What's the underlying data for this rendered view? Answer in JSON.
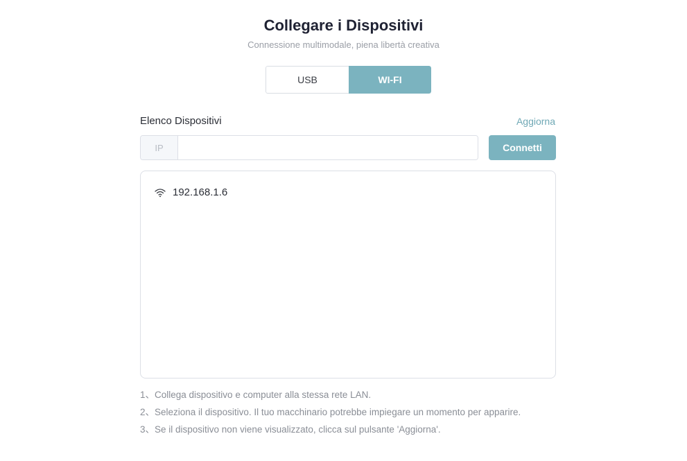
{
  "header": {
    "title": "Collegare i Dispositivi",
    "subtitle": "Connessione multimodale, piena libertà creativa"
  },
  "tabs": [
    {
      "label": "USB",
      "active": false
    },
    {
      "label": "WI-FI",
      "active": true
    }
  ],
  "device_list": {
    "label": "Elenco Dispositivi",
    "refresh_label": "Aggiorna",
    "ip_prefix": "IP",
    "ip_value": "",
    "ip_placeholder": "",
    "connect_label": "Connetti",
    "devices": [
      {
        "ip": "192.168.1.6",
        "icon": "wifi-icon"
      }
    ]
  },
  "notes": [
    "1、Collega dispositivo e computer alla stessa rete LAN.",
    "2、Seleziona il dispositivo. Il tuo macchinario potrebbe impiegare un momento per apparire.",
    "3、Se il dispositivo non viene visualizzato, clicca sul pulsante 'Aggiorna'."
  ],
  "colors": {
    "accent": "#7bb3bf",
    "link": "#6fa8b5",
    "title": "#1f2233",
    "muted": "#9a9ea6"
  }
}
